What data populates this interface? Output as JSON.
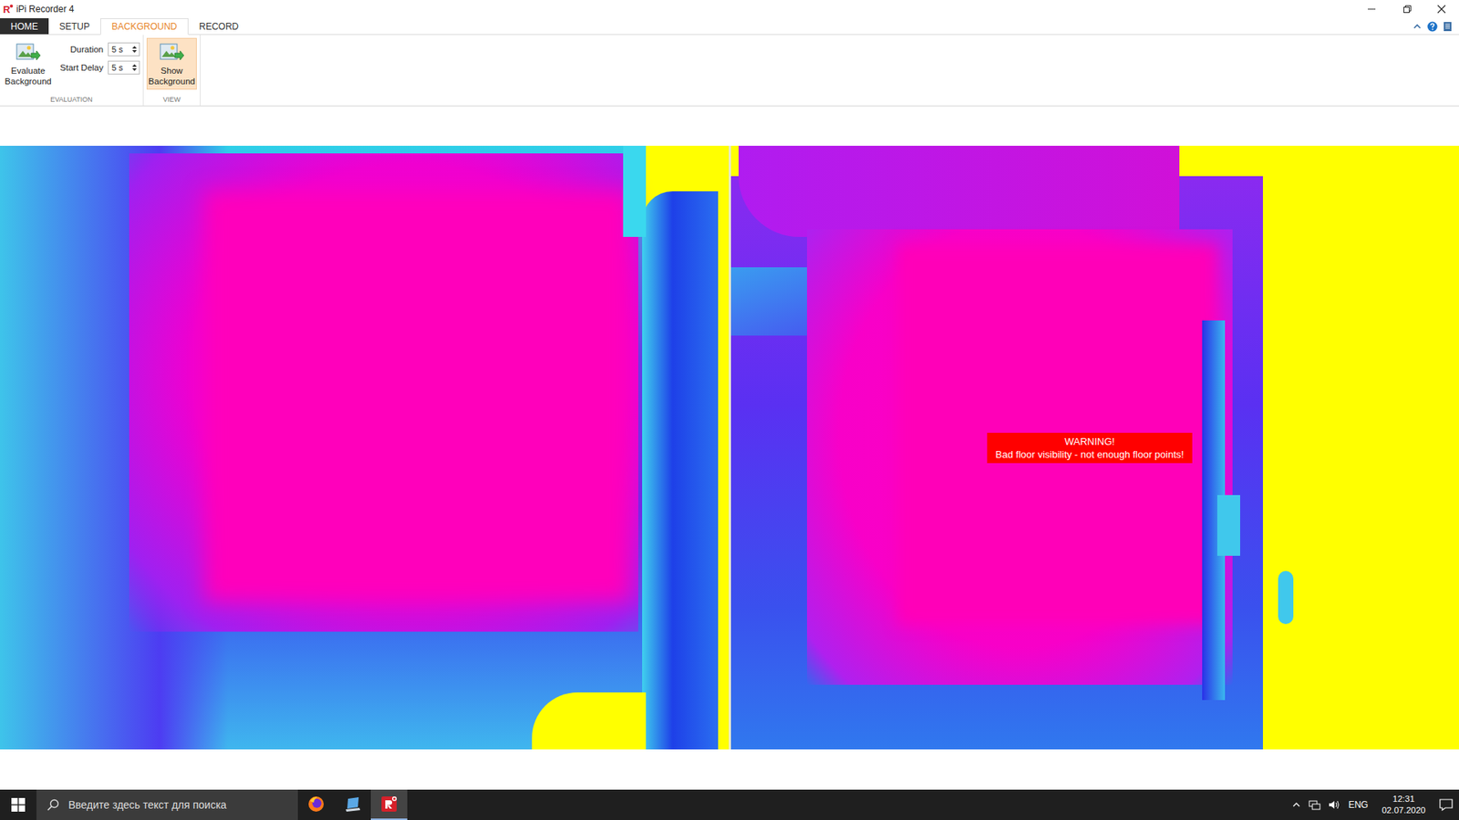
{
  "window": {
    "logo": "R",
    "title": "iPi Recorder 4"
  },
  "ribbon_tabs": [
    {
      "label": "HOME",
      "kind": "file",
      "selected": false
    },
    {
      "label": "SETUP",
      "kind": "tab",
      "selected": false
    },
    {
      "label": "BACKGROUND",
      "kind": "tab",
      "selected": true
    },
    {
      "label": "RECORD",
      "kind": "tab",
      "selected": false
    }
  ],
  "ribbon": {
    "groups": [
      {
        "label": "EVALUATION",
        "items": [
          {
            "kind": "button",
            "label": "Evaluate Background"
          },
          {
            "kind": "spinner",
            "label": "Duration",
            "value": "5 s"
          },
          {
            "kind": "spinner",
            "label": "Start Delay",
            "value": "5 s"
          }
        ]
      },
      {
        "label": "VIEW",
        "items": [
          {
            "kind": "toggle",
            "label": "Show Background",
            "pressed": true
          }
        ]
      }
    ]
  },
  "warning": {
    "title": "WARNING!",
    "message": "Bad floor visibility - not enough floor points!"
  },
  "taskbar": {
    "search_placeholder": "Введите здесь текст для поиска",
    "apps": [
      {
        "kind": "firefox",
        "active": false
      },
      {
        "kind": "laptop",
        "active": false
      },
      {
        "kind": "ipi",
        "active": true
      }
    ],
    "tray": {
      "language": "ENG",
      "time": "12:31",
      "date": "02.07.2020"
    }
  }
}
